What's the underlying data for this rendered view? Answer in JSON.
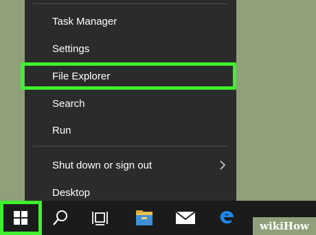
{
  "context_menu": {
    "items": [
      {
        "label": "Task Manager"
      },
      {
        "label": "Settings"
      },
      {
        "label": "File Explorer"
      },
      {
        "label": "Search"
      },
      {
        "label": "Run"
      },
      {
        "label": "Shut down or sign out",
        "submenu": true
      },
      {
        "label": "Desktop"
      }
    ]
  },
  "taskbar": {
    "buttons": [
      "windows-start-icon",
      "search-icon",
      "task-view-icon",
      "file-explorer-icon",
      "mail-icon",
      "edge-browser-icon"
    ]
  },
  "watermark": {
    "part1": "wiki",
    "part2": "How"
  },
  "colors": {
    "highlight": "#3ef02d",
    "menu_bg": "#2b2b2b",
    "taskbar_bg": "#1b1b1b",
    "desktop": "#8fa07b"
  }
}
